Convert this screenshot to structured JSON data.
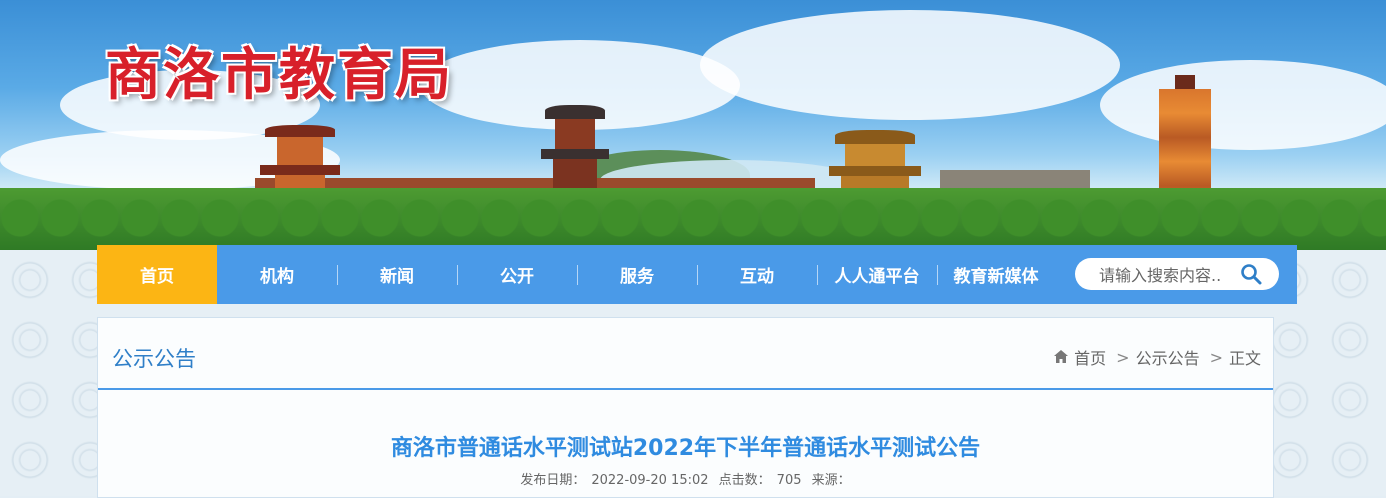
{
  "site": {
    "title": "商洛市教育局"
  },
  "nav": {
    "items": [
      "首页",
      "机构",
      "新闻",
      "公开",
      "服务",
      "互动",
      "人人通平台",
      "教育新媒体"
    ],
    "active_index": 0,
    "search_placeholder": "请输入搜索内容..",
    "search_icon": "search-icon"
  },
  "panel": {
    "title": "公示公告",
    "breadcrumb": {
      "home_icon": "home-icon",
      "items": [
        "首页",
        "公示公告",
        "正文"
      ],
      "separator": ">"
    }
  },
  "article": {
    "title": "商洛市普通话水平测试站2022年下半年普通话水平测试公告",
    "publish_label": "发布日期：",
    "publish_date": "2022-09-20 15:02",
    "clicks_label": "点击数：",
    "clicks": "705",
    "source_label": "来源："
  },
  "colors": {
    "nav": "#4a9ae8",
    "nav_active": "#fcb514",
    "title_red": "#d8202a",
    "article_title": "#2f8be0"
  }
}
